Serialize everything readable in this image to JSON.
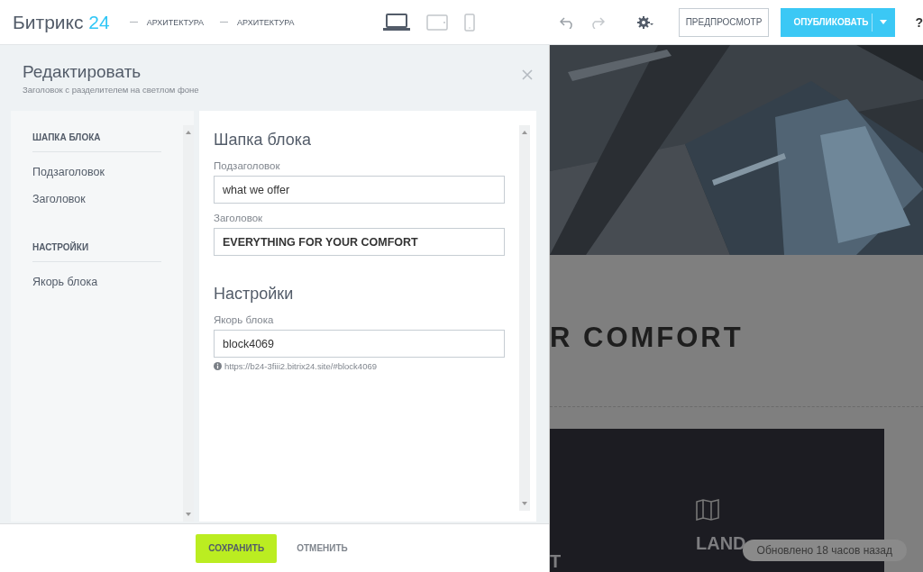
{
  "topbar": {
    "logo": {
      "name": "Битрикс",
      "number": "24"
    },
    "breadcrumbs": [
      "АРХИТЕКТУРА",
      "АРХИТЕКТУРА"
    ],
    "devices": [
      {
        "kind": "desktop",
        "selected": true
      },
      {
        "kind": "tablet",
        "selected": false
      },
      {
        "kind": "mobile",
        "selected": false
      }
    ],
    "preview_button": "ПРЕДПРОСМОТР",
    "publish_button": "ОПУБЛИКОВАТЬ",
    "help": "?"
  },
  "editor": {
    "title": "Редактировать",
    "subtitle": "Заголовок с разделителем на светлом фоне",
    "nav": [
      {
        "heading": "ШАПКА БЛОКА",
        "items": [
          "Подзаголовок",
          "Заголовок"
        ]
      },
      {
        "heading": "НАСТРОЙКИ",
        "items": [
          "Якорь блока"
        ]
      }
    ],
    "sections": [
      {
        "title": "Шапка блока",
        "fields": [
          {
            "label": "Подзаголовок",
            "value": "what we offer",
            "bold": false
          },
          {
            "label": "Заголовок",
            "value": "EVERYTHING FOR YOUR COMFORT",
            "bold": true
          }
        ]
      },
      {
        "title": "Настройки",
        "fields": [
          {
            "label": "Якорь блока",
            "value": "block4069",
            "bold": false,
            "hint": "https://b24-3fiii2.bitrix24.site/#block4069"
          }
        ]
      }
    ],
    "save_button": "СОХРАНИТЬ",
    "cancel_button": "ОТМЕНИТЬ"
  },
  "preview": {
    "heading": "R COMFORT",
    "cards": [
      {
        "title": "T"
      },
      {
        "title": "LAND"
      }
    ],
    "status": "Обновлено 18 часов назад"
  }
}
